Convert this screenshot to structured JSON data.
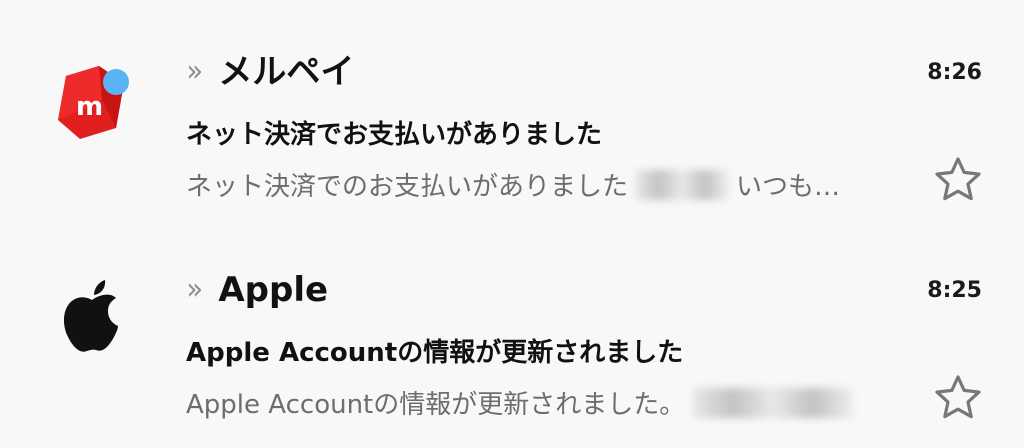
{
  "messages": [
    {
      "sender": "メルペイ",
      "time": "8:26",
      "subject": "ネット決済でお支払いがありました",
      "preview_before": "ネット決済でのお支払いがありました",
      "preview_after": "いつも…",
      "avatar_icon": "merpay-logo-icon",
      "avatar_color": "#e62020",
      "avatar_dot_color": "#5ab3f3",
      "starred": false
    },
    {
      "sender": "Apple",
      "time": "8:25",
      "subject": "Apple Accountの情報が更新されました",
      "preview_before": "Apple Accountの情報が更新されました。",
      "preview_after": "",
      "avatar_icon": "apple-logo-icon",
      "avatar_color": "#111111",
      "starred": false
    }
  ],
  "ui": {
    "chevron_symbol": "»"
  }
}
